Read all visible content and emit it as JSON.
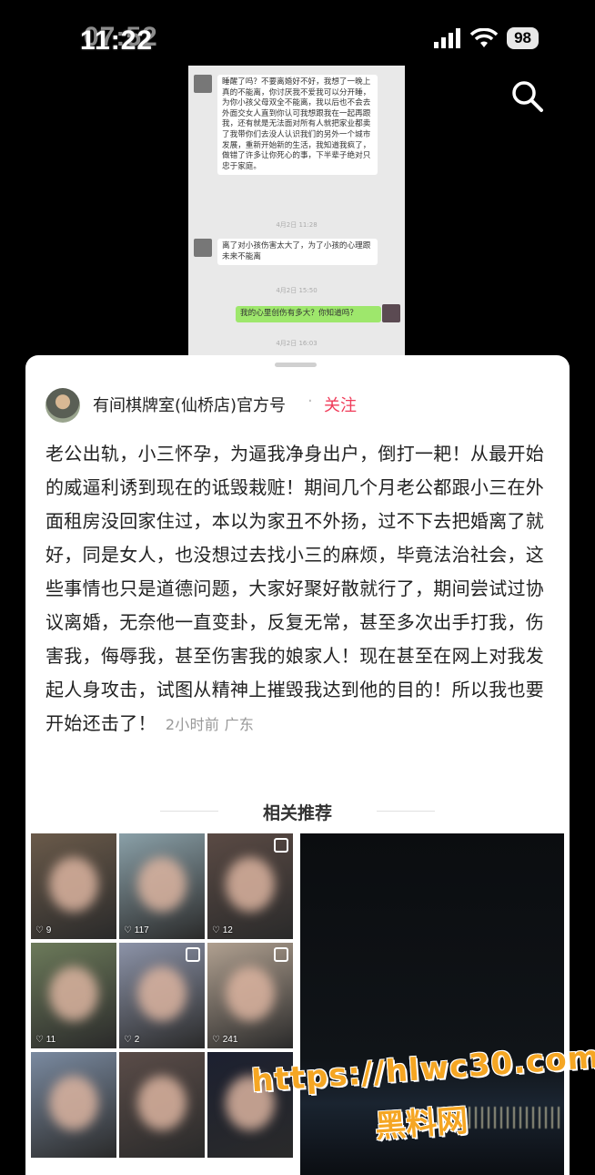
{
  "status_bar": {
    "time": "11:22",
    "time_ghost": "07:52",
    "battery": "98"
  },
  "chat_screenshot": {
    "messages": [
      {
        "text": "睡醒了吗？不要离婚好不好，我想了一晚上真的不能离，你讨厌我不爱我可以分开睡，为你小孩父母双全不能离，我以后也不会去外面交女人直到你认可我想跟我在一起再跟我，还有就是无法面对所有人就把家业都卖了我带你们去没人认识我们的另外一个城市发展，重新开始新的生活，我知道我疯了，做错了许多让你死心的事，下半辈子绝对只忠于家庭。",
        "side": "left"
      },
      {
        "text": "离了对小孩伤害太大了，为了小孩的心理跟未来不能离",
        "side": "left"
      },
      {
        "text": "我的心里创伤有多大？你知道吗？",
        "side": "right"
      }
    ],
    "times": [
      "4月2日 11:28",
      "4月2日 15:50",
      "4月2日 16:03"
    ]
  },
  "post": {
    "author": "有间棋牌室(仙桥店)官方号",
    "follow_label": "关注",
    "body": "老公出轨，小三怀孕，为逼我净身出户，倒打一耙！从最开始的威逼利诱到现在的诋毁栽赃！期间几个月老公都跟小三在外面租房没回家住过，本以为家丑不外扬，过不下去把婚离了就好，同是女人，也没想过去找小三的麻烦，毕竟法治社会，这些事情也只是道德问题，大家好聚好散就行了，期间尝试过协议离婚，无奈他一直变卦，反复无常，甚至多次出手打我，伤害我，侮辱我，甚至伤害我的娘家人！现在甚至在网上对我发起人身攻击，试图从精神上摧毁我达到他的目的！所以我也要开始还击了！",
    "meta": "2小时前 广东"
  },
  "related": {
    "title": "相关推荐",
    "thumbs": [
      {
        "likes": "9",
        "color": "#6a5a4a"
      },
      {
        "likes": "117",
        "color": "#8aa0a8"
      },
      {
        "likes": "12",
        "color": "#5a4a44"
      },
      {
        "likes": "11",
        "color": "#6c7a5a"
      },
      {
        "likes": "2",
        "color": "#8c93a8"
      },
      {
        "likes": "241",
        "color": "#b0a090"
      },
      {
        "likes": "",
        "color": "#7a8aa0"
      },
      {
        "likes": "",
        "color": "#5a4c48"
      },
      {
        "likes": "",
        "color": "#1c2030"
      }
    ]
  },
  "watermark": {
    "url": "https://hlwc30.com",
    "name": "黑料网"
  }
}
